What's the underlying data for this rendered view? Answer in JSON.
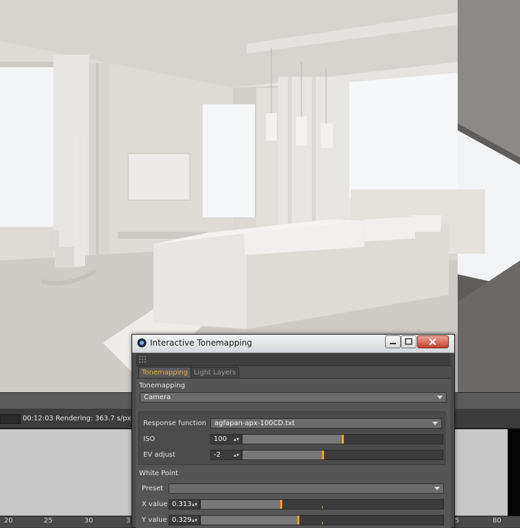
{
  "window": {
    "title": "Interactive Tonemapping",
    "tabs": [
      {
        "label": "Tonemapping",
        "active": true
      },
      {
        "label": "Light Layers",
        "active": false
      }
    ]
  },
  "tonemapping": {
    "section_label": "Tonemapping",
    "mode": "Camera",
    "response_function": {
      "label": "Response function",
      "value": "agfapan-apx-100CD.txt"
    },
    "iso": {
      "label": "ISO",
      "value": "100",
      "slider_fraction": 0.5
    },
    "ev_adjust": {
      "label": "EV adjust",
      "value": "-2",
      "slider_fraction": 0.4
    }
  },
  "white_point": {
    "section_label": "White Point",
    "preset": {
      "label": "Preset",
      "value": ""
    },
    "x_value": {
      "label": "X value",
      "value": "0.313",
      "slider_fraction": 0.33
    },
    "y_value": {
      "label": "Y value",
      "value": "0.329",
      "slider_fraction": 0.4
    }
  },
  "status": {
    "render_text": "00:12:03 Rendering: 363.7 s/px"
  },
  "timeline": {
    "ticks": [
      "20",
      "25",
      "30",
      "3",
      "5",
      "80"
    ]
  },
  "colors": {
    "accent": "#f0a020",
    "active_tab_text": "#f0a93a"
  }
}
